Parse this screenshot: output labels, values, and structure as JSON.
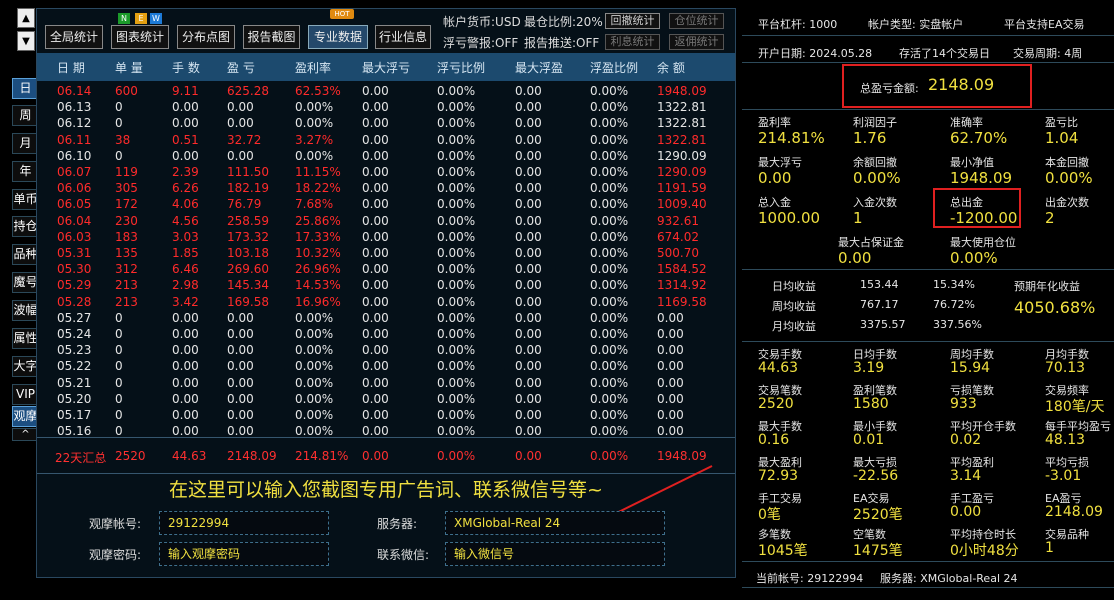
{
  "left_nav": {
    "up_arrow": "▲",
    "down_arrow": "▼",
    "tabs": [
      "日",
      "周",
      "月",
      "年",
      "单币",
      "持仓",
      "品种",
      "魔号",
      "波幅",
      "属性",
      "大字",
      "VIP",
      "观摩"
    ],
    "collapse": "^"
  },
  "toolbar": {
    "buttons": [
      "全局统计",
      "图表统计",
      "分布点图",
      "报告截图",
      "专业数据",
      "行业信息"
    ],
    "new_badge": [
      "N",
      "E",
      "W"
    ],
    "hot_badge": "HOT",
    "currency": "帐户货币:USD",
    "position_ratio": "最仓比例:20%",
    "float_alert": "浮亏警报:OFF",
    "report_push": "报告推送:OFF",
    "small_buttons": [
      "回撤统计",
      "仓位统计",
      "利息统计",
      "返佣统计"
    ]
  },
  "table": {
    "headers": [
      "日 期",
      "单 量",
      "手 数",
      "盈 亏",
      "盈利率",
      "最大浮亏",
      "浮亏比例",
      "最大浮盈",
      "浮盈比例",
      "余 额"
    ],
    "rows": [
      [
        "06.14",
        "600",
        "9.11",
        "625.28",
        "62.53%",
        "0.00",
        "0.00%",
        "0.00",
        "0.00%",
        "1948.09"
      ],
      [
        "06.13",
        "0",
        "0.00",
        "0.00",
        "0.00%",
        "0.00",
        "0.00%",
        "0.00",
        "0.00%",
        "1322.81"
      ],
      [
        "06.12",
        "0",
        "0.00",
        "0.00",
        "0.00%",
        "0.00",
        "0.00%",
        "0.00",
        "0.00%",
        "1322.81"
      ],
      [
        "06.11",
        "38",
        "0.51",
        "32.72",
        "3.27%",
        "0.00",
        "0.00%",
        "0.00",
        "0.00%",
        "1322.81"
      ],
      [
        "06.10",
        "0",
        "0.00",
        "0.00",
        "0.00%",
        "0.00",
        "0.00%",
        "0.00",
        "0.00%",
        "1290.09"
      ],
      [
        "06.07",
        "119",
        "2.39",
        "111.50",
        "11.15%",
        "0.00",
        "0.00%",
        "0.00",
        "0.00%",
        "1290.09"
      ],
      [
        "06.06",
        "305",
        "6.26",
        "182.19",
        "18.22%",
        "0.00",
        "0.00%",
        "0.00",
        "0.00%",
        "1191.59"
      ],
      [
        "06.05",
        "172",
        "4.06",
        "76.79",
        "7.68%",
        "0.00",
        "0.00%",
        "0.00",
        "0.00%",
        "1009.40"
      ],
      [
        "06.04",
        "230",
        "4.56",
        "258.59",
        "25.86%",
        "0.00",
        "0.00%",
        "0.00",
        "0.00%",
        "932.61"
      ],
      [
        "06.03",
        "183",
        "3.03",
        "173.32",
        "17.33%",
        "0.00",
        "0.00%",
        "0.00",
        "0.00%",
        "674.02"
      ],
      [
        "05.31",
        "135",
        "1.85",
        "103.18",
        "10.32%",
        "0.00",
        "0.00%",
        "0.00",
        "0.00%",
        "500.70"
      ],
      [
        "05.30",
        "312",
        "6.46",
        "269.60",
        "26.96%",
        "0.00",
        "0.00%",
        "0.00",
        "0.00%",
        "1584.52"
      ],
      [
        "05.29",
        "213",
        "2.98",
        "145.34",
        "14.53%",
        "0.00",
        "0.00%",
        "0.00",
        "0.00%",
        "1314.92"
      ],
      [
        "05.28",
        "213",
        "3.42",
        "169.58",
        "16.96%",
        "0.00",
        "0.00%",
        "0.00",
        "0.00%",
        "1169.58"
      ],
      [
        "05.27",
        "0",
        "0.00",
        "0.00",
        "0.00%",
        "0.00",
        "0.00%",
        "0.00",
        "0.00%",
        "0.00"
      ],
      [
        "05.24",
        "0",
        "0.00",
        "0.00",
        "0.00%",
        "0.00",
        "0.00%",
        "0.00",
        "0.00%",
        "0.00"
      ],
      [
        "05.23",
        "0",
        "0.00",
        "0.00",
        "0.00%",
        "0.00",
        "0.00%",
        "0.00",
        "0.00%",
        "0.00"
      ],
      [
        "05.22",
        "0",
        "0.00",
        "0.00",
        "0.00%",
        "0.00",
        "0.00%",
        "0.00",
        "0.00%",
        "0.00"
      ],
      [
        "05.21",
        "0",
        "0.00",
        "0.00",
        "0.00%",
        "0.00",
        "0.00%",
        "0.00",
        "0.00%",
        "0.00"
      ],
      [
        "05.20",
        "0",
        "0.00",
        "0.00",
        "0.00%",
        "0.00",
        "0.00%",
        "0.00",
        "0.00%",
        "0.00"
      ],
      [
        "05.17",
        "0",
        "0.00",
        "0.00",
        "0.00%",
        "0.00",
        "0.00%",
        "0.00",
        "0.00%",
        "0.00"
      ],
      [
        "05.16",
        "0",
        "0.00",
        "0.00",
        "0.00%",
        "0.00",
        "0.00%",
        "0.00",
        "0.00%",
        "0.00"
      ]
    ],
    "highlight_rows": [
      0,
      3,
      5,
      6,
      7,
      8,
      9,
      10,
      11,
      12,
      13
    ],
    "summary": [
      "22天汇总",
      "2520",
      "44.63",
      "2148.09",
      "214.81%",
      "0.00",
      "0.00%",
      "0.00",
      "0.00%",
      "1948.09"
    ]
  },
  "ad_text": "在这里可以输入您截图专用广告词、联系微信号等~",
  "form": {
    "account_label": "观摩帐号:",
    "account_value": "29122994",
    "password_label": "观摩密码:",
    "password_placeholder": "输入观摩密码",
    "server_label": "服务器:",
    "server_value": "XMGlobal-Real 24",
    "wechat_label": "联系微信:",
    "wechat_placeholder": "输入微信号"
  },
  "right": {
    "header": {
      "leverage": "平台杠杆: 1000",
      "account_type": "帐户类型: 实盘帐户",
      "ea_support": "平台支持EA交易"
    },
    "info": {
      "open_date": "开户日期: 2024.05.28",
      "existence": "存活了14个交易日",
      "cycle": "交易周期: 4周"
    },
    "total_pl_label": "总盈亏金额:",
    "total_pl_value": "2148.09",
    "grid1": [
      [
        "盈利率",
        "214.81%"
      ],
      [
        "利润因子",
        "1.76"
      ],
      [
        "准确率",
        "62.70%"
      ],
      [
        "盈亏比",
        "1.04"
      ],
      [
        "最大浮亏",
        "0.00"
      ],
      [
        "余额回撤",
        "0.00%"
      ],
      [
        "最小净值",
        "1948.09"
      ],
      [
        "本金回撤",
        "0.00%"
      ],
      [
        "总入金",
        "1000.00"
      ],
      [
        "入金次数",
        "1"
      ],
      [
        "总出金",
        "-1200.00"
      ],
      [
        "出金次数",
        "2"
      ],
      [
        "最大占保证金",
        "0.00"
      ],
      [
        "最大使用仓位",
        "0.00%"
      ]
    ],
    "avg": {
      "rows": [
        [
          "日均收益",
          "153.44",
          "15.34%"
        ],
        [
          "周均收益",
          "767.17",
          "76.72%"
        ],
        [
          "月均收益",
          "3375.57",
          "337.56%"
        ]
      ],
      "annual_label": "预期年化收益",
      "annual_value": "4050.68%"
    },
    "grid2": [
      [
        "交易手数",
        "44.63"
      ],
      [
        "日均手数",
        "3.19"
      ],
      [
        "周均手数",
        "15.94"
      ],
      [
        "月均手数",
        "70.13"
      ],
      [
        "交易笔数",
        "2520"
      ],
      [
        "盈利笔数",
        "1580"
      ],
      [
        "亏损笔数",
        "933"
      ],
      [
        "交易频率",
        "180笔/天"
      ],
      [
        "最大手数",
        "0.16"
      ],
      [
        "最小手数",
        "0.01"
      ],
      [
        "平均开仓手数",
        "0.02"
      ],
      [
        "每手平均盈亏",
        "48.13"
      ],
      [
        "最大盈利",
        "72.93"
      ],
      [
        "最大亏损",
        "-22.56"
      ],
      [
        "平均盈利",
        "3.14"
      ],
      [
        "平均亏损",
        "-3.01"
      ],
      [
        "手工交易",
        "0笔"
      ],
      [
        "EA交易",
        "2520笔"
      ],
      [
        "手工盈亏",
        "0.00"
      ],
      [
        "EA盈亏",
        "2148.09"
      ],
      [
        "多笔数",
        "1045笔"
      ],
      [
        "空笔数",
        "1475笔"
      ],
      [
        "平均持仓时长",
        "0小时48分"
      ],
      [
        "交易品种",
        "1"
      ]
    ],
    "footer": {
      "account": "当前帐号: 29122994",
      "server": "服务器: XMGlobal-Real 24"
    }
  },
  "colors": {
    "accent_yellow": "#f0e040",
    "loss_red": "#ff2b2b",
    "header_blue": "#1c4a6e",
    "highlight_box": "#e02020"
  }
}
